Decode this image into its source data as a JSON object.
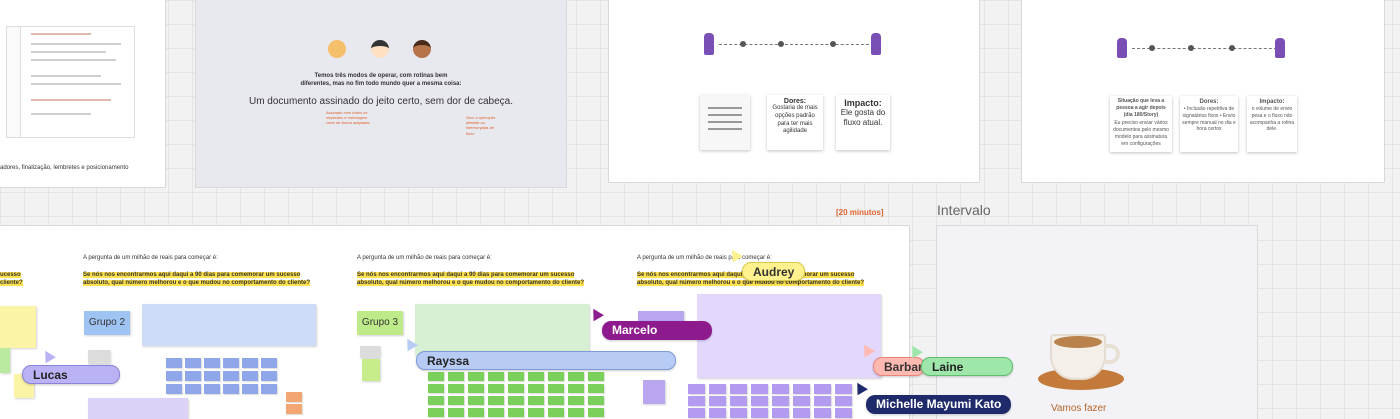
{
  "board": {
    "frame1": {
      "caption": "adores, finalização, lembretes e posicionamento"
    },
    "frame2": {
      "line1": "Temos três modos de operar, com rotinas bem",
      "line2": "diferentes, mas no fim todo mundo quer a mesma coisa:",
      "headline": "Um documento assinado do jeito certo, sem dor de cabeça.",
      "note1": "Assinado com todos os requisitos e mensagem certo de forma adaptada",
      "note2": "Sem a operação afetada ou interrompida de fluxo"
    },
    "frame3": {
      "card2_title": "Dores:",
      "card2_text": "Gostaria de mais opções padrão para ter mais agilidade",
      "card3_title": "Impacto:",
      "card3_text": "Ele gosta do fluxo atual."
    },
    "frame4": {
      "card1_title": "Situação que leva a pessoa a agir depois (dia 180/Story)",
      "card1_text": "Eu preciso enviar vários documentos pelo mesmo modelo para assinatura em configurações",
      "card2_title": "Dores:",
      "card2_text": "• Inclusão repetitiva de signatários fixos • Envio sempre manual no dia e hora certos",
      "card3_title": "Impacto:",
      "card3_text": "o volume de envio pesa e o fluxo não acompanha a rotina dele."
    },
    "time_label": "[20 minutos]",
    "intervalo": "Intervalo",
    "vamos_fazer": "Vamos fazer",
    "question_intro": "A pergunta de um milhão de reais para começar é:",
    "question": "Se nós nos encontrarmos aqui daqui a 90 dias para comemorar um sucesso absoluto, qual número melhorou e o que mudou no comportamento do cliente?",
    "groups": {
      "g2": "Grupo 2",
      "g3": "Grupo 3"
    }
  },
  "cursors": [
    {
      "name": "Lucas",
      "color": "#b9b3f5"
    },
    {
      "name": "Audrey",
      "color": "#fdf28e"
    },
    {
      "name": "Marcelo",
      "color": "#8e1b8e"
    },
    {
      "name": "Rayssa",
      "color": "#b7cbf5"
    },
    {
      "name": "Barbara",
      "color": "#ffb9b1"
    },
    {
      "name": "Laine",
      "color": "#9ee6a9"
    },
    {
      "name": "Michelle Mayumi Kato",
      "color": "#1f2a6b"
    }
  ]
}
